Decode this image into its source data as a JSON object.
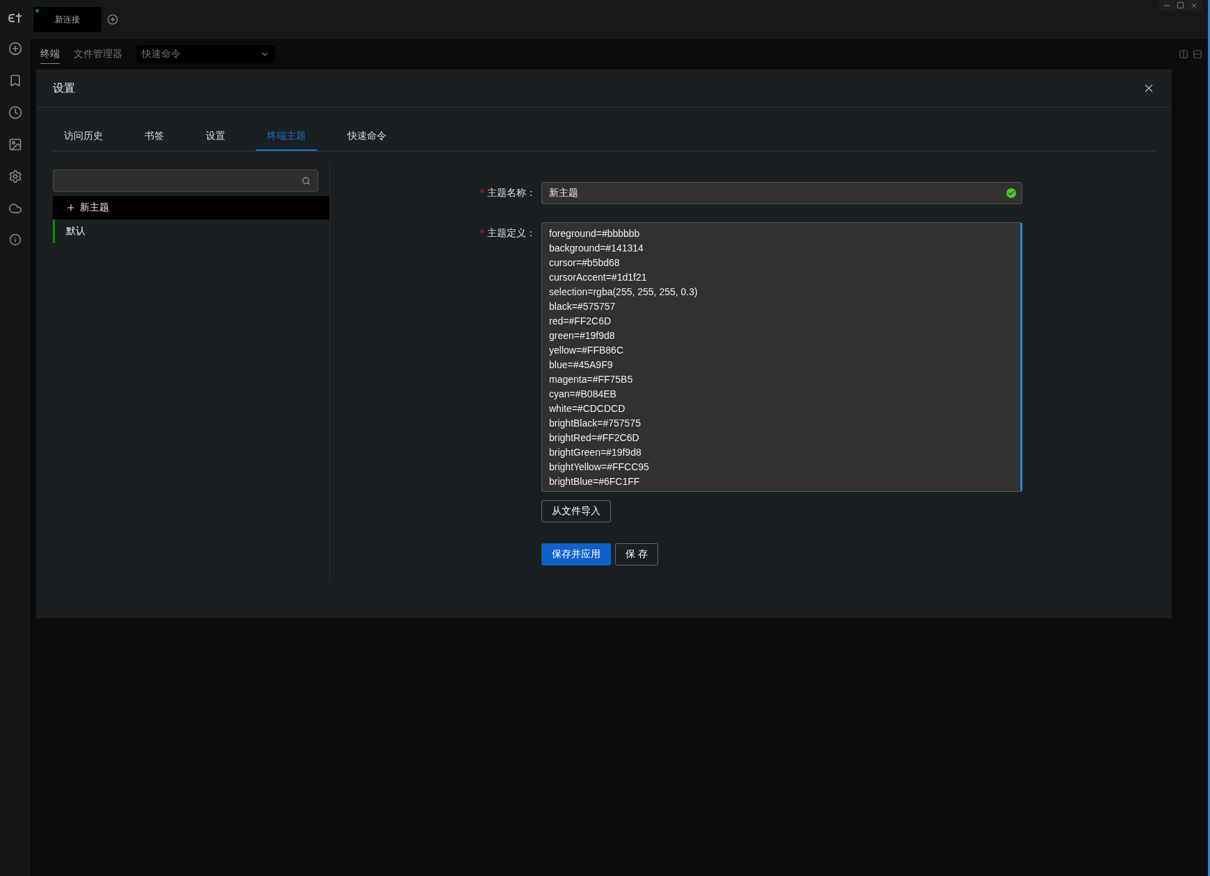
{
  "connection_tabs": [
    {
      "label": "新连接",
      "selected": true,
      "connected": true
    }
  ],
  "view_tabs": [
    {
      "label": "终端",
      "selected": true
    },
    {
      "label": "文件管理器",
      "selected": false
    }
  ],
  "quick_command_select": {
    "placeholder": "快速命令"
  },
  "dialog": {
    "title": "设置",
    "tabs": [
      {
        "label": "访问历史",
        "selected": false
      },
      {
        "label": "书签",
        "selected": false
      },
      {
        "label": "设置",
        "selected": false
      },
      {
        "label": "终端主题",
        "selected": true
      },
      {
        "label": "快速命令",
        "selected": false
      }
    ],
    "theme_list": [
      {
        "kind": "add",
        "label": "新主题",
        "selected": false
      },
      {
        "kind": "theme",
        "label": "默认",
        "selected": true
      }
    ],
    "form": {
      "required_mark": "*",
      "name_label": "主题名称：",
      "name_value": "新主题",
      "name_valid": true,
      "definition_label": "主题定义：",
      "definition_lines": [
        "foreground=#bbbbbb",
        "background=#141314",
        "cursor=#b5bd68",
        "cursorAccent=#1d1f21",
        "selection=rgba(255, 255, 255, 0.3)",
        "black=#575757",
        "red=#FF2C6D",
        "green=#19f9d8",
        "yellow=#FFB86C",
        "blue=#45A9F9",
        "magenta=#FF75B5",
        "cyan=#B084EB",
        "white=#CDCDCD",
        "brightBlack=#757575",
        "brightRed=#FF2C6D",
        "brightGreen=#19f9d8",
        "brightYellow=#FFCC95",
        "brightBlue=#6FC1FF"
      ],
      "import_button": "从文件导入",
      "save_apply_button": "保存并应用",
      "save_button": "保 存"
    }
  }
}
